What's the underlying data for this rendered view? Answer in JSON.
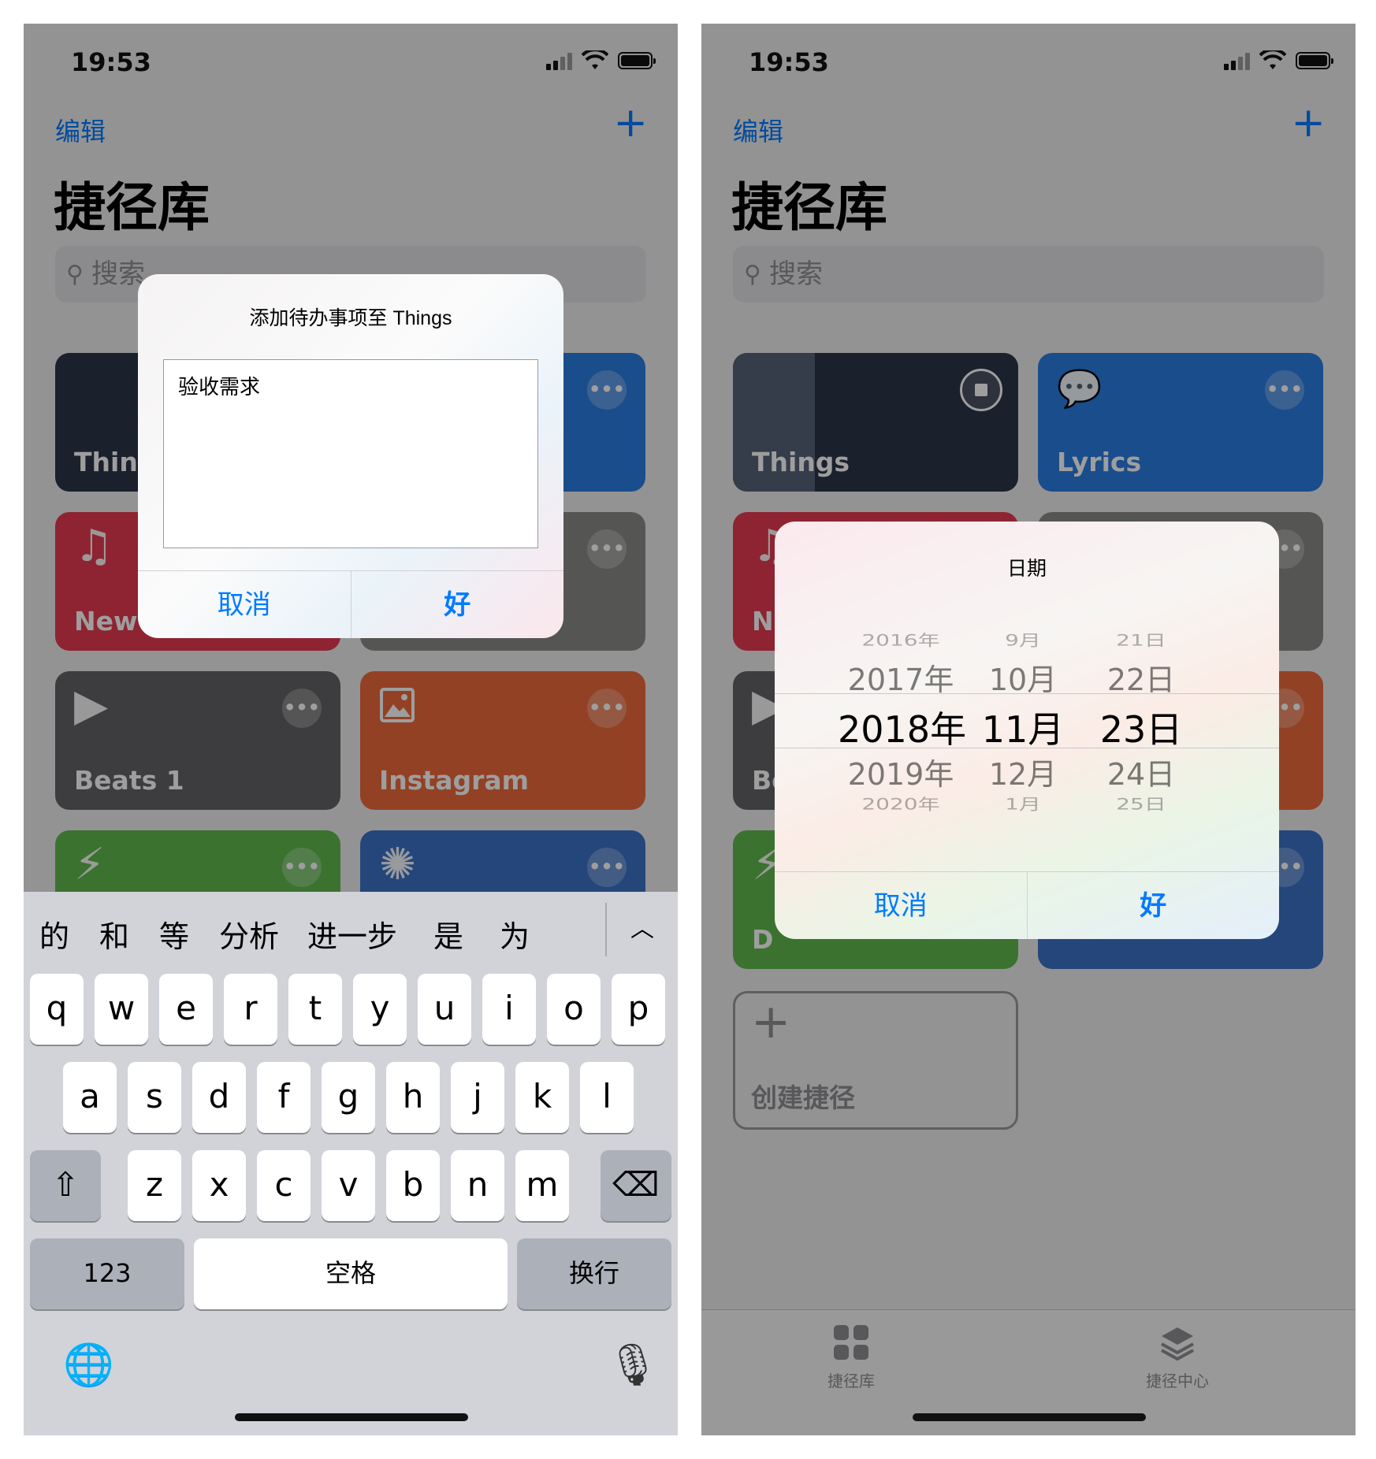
{
  "status": {
    "time": "19:53"
  },
  "nav": {
    "edit": "编辑",
    "add": "+"
  },
  "title": "捷径库",
  "search": {
    "placeholder": "搜索"
  },
  "more_glyph": "•••",
  "tiles": {
    "things": "Things",
    "lyrics": "Lyrics",
    "new": "New",
    "beats": "Beats 1",
    "instagram": "Instagram",
    "d_partial": "D"
  },
  "create": {
    "plus": "+",
    "label": "创建捷径"
  },
  "tabbar": {
    "library": "捷径库",
    "gallery": "捷径中心"
  },
  "alert_text": {
    "title": "添加待办事项至 Things",
    "value": "验收需求",
    "cancel": "取消",
    "ok": "好"
  },
  "alert_date": {
    "title": "日期",
    "cancel": "取消",
    "ok": "好",
    "years": [
      "2016年",
      "2017年",
      "2018年",
      "2019年",
      "2020年"
    ],
    "months": [
      "9月",
      "10月",
      "11月",
      "12月",
      "1月"
    ],
    "days": [
      "21日",
      "22日",
      "23日",
      "24日",
      "25日"
    ],
    "selected": {
      "year": "2018年",
      "month": "11月",
      "day": "23日"
    }
  },
  "keyboard": {
    "candidates": [
      "的",
      "和",
      "等",
      "分析",
      "进一步",
      "是",
      "为"
    ],
    "expand": "︿",
    "row1": [
      "q",
      "w",
      "e",
      "r",
      "t",
      "y",
      "u",
      "i",
      "o",
      "p"
    ],
    "row2": [
      "a",
      "s",
      "d",
      "f",
      "g",
      "h",
      "j",
      "k",
      "l"
    ],
    "row3": [
      "z",
      "x",
      "c",
      "v",
      "b",
      "n",
      "m"
    ],
    "shift": "⇧",
    "delete": "⌫",
    "numbers": "123",
    "space": "空格",
    "return": "换行",
    "globe": "🌐",
    "mic": "🎙"
  },
  "colors": {
    "accent": "#007aff",
    "things": "#2a3447",
    "lyrics": "#2b7de0",
    "music": "#e63a50",
    "gray": "#8a8c87",
    "beats": "#636366",
    "instagram": "#ed6a3d",
    "green": "#5fb94e",
    "blue": "#3d72c7"
  },
  "icons": [
    "signal-icon",
    "wifi-icon",
    "battery-icon",
    "search-icon",
    "more-icon",
    "stop-icon",
    "music-note-icon",
    "heart-icon",
    "play-icon",
    "image-icon",
    "bolt-icon",
    "spinner-icon",
    "speech-bubble-icon",
    "grid-icon",
    "layers-icon",
    "globe-icon",
    "microphone-icon",
    "shift-icon",
    "delete-icon"
  ]
}
